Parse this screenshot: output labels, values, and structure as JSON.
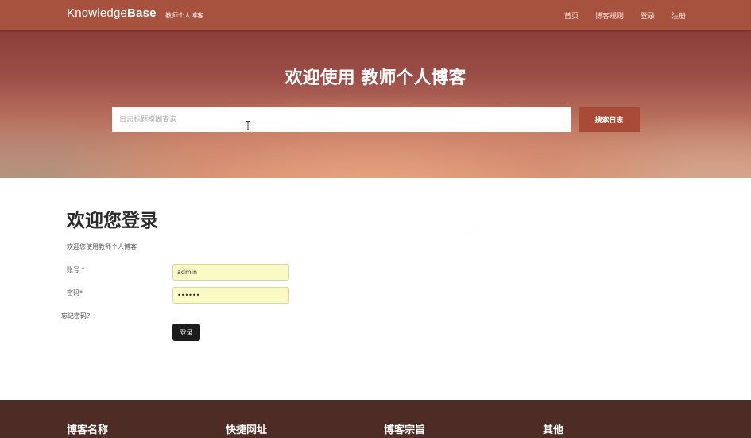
{
  "header": {
    "brand_light": "Knowledge",
    "brand_bold": "Base",
    "brand_sub": "教师个人博客",
    "nav": [
      "首页",
      "博客规则",
      "登录",
      "注册"
    ]
  },
  "hero": {
    "title": "欢迎使用 教师个人博客",
    "search_placeholder": "日志标题模糊查询",
    "search_button": "搜索日志"
  },
  "login": {
    "title": "欢迎您登录",
    "subtitle": "欢迎您使用教师个人博客",
    "username_label": "账号 *",
    "username_value": "admin",
    "password_label": "密码*",
    "password_value": "123456",
    "forgot": "忘记密码？",
    "submit": "登录"
  },
  "footer": {
    "columns": [
      "博客名称",
      "快捷网址",
      "博客宗旨",
      "其他"
    ]
  },
  "colors": {
    "topbar": "#a7523f",
    "search_button": "#a84a35",
    "footer": "#4d2c25",
    "input_autofill": "#fafac4"
  }
}
